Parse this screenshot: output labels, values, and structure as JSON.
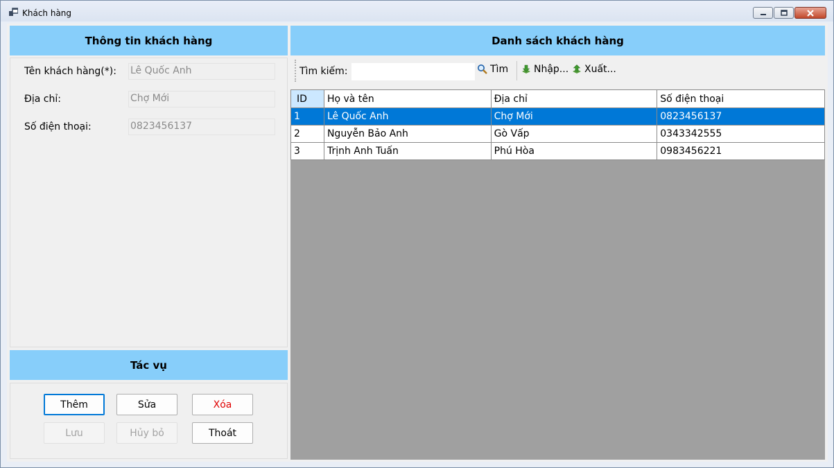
{
  "window": {
    "title": "Khách hàng",
    "controls": [
      "minimize-icon",
      "maximize-icon",
      "close-icon"
    ]
  },
  "info_panel": {
    "header": "Thông tin khách hàng",
    "fields": [
      {
        "label": "Tên khách hàng(*):",
        "value": "Lê Quốc Anh"
      },
      {
        "label": "Địa chỉ:",
        "value": "Chợ Mới"
      },
      {
        "label": "Số điện thoại:",
        "value": "0823456137"
      }
    ]
  },
  "actions_panel": {
    "header": "Tác vụ",
    "buttons": {
      "add": "Thêm",
      "edit": "Sửa",
      "delete": "Xóa",
      "save": "Lưu",
      "cancel": "Hủy bỏ",
      "exit": "Thoát"
    }
  },
  "list_panel": {
    "header": "Danh sách khách hàng",
    "toolbar": {
      "search_label": "Tìm kiếm:",
      "search_value": "",
      "search_button": "Tìm",
      "import_button": "Nhập...",
      "export_button": "Xuất..."
    },
    "table": {
      "columns": [
        "ID",
        "Họ và tên",
        "Địa chỉ",
        "Số điện thoại"
      ],
      "rows": [
        {
          "id": "1",
          "name": "Lê Quốc Anh",
          "address": "Chợ Mới",
          "phone": "0823456137",
          "selected": true
        },
        {
          "id": "2",
          "name": "Nguyễn Bảo Anh",
          "address": "Gò Vấp",
          "phone": "0343342555",
          "selected": false
        },
        {
          "id": "3",
          "name": "Trịnh Anh Tuấn",
          "address": "Phú Hòa",
          "phone": "0983456221",
          "selected": false
        }
      ]
    }
  },
  "colors": {
    "header_bg": "#87cefa",
    "selection": "#0078d7",
    "grid_bg": "#a0a0a0",
    "delete_text": "#e00000",
    "form_bg": "#f0f0f0"
  }
}
